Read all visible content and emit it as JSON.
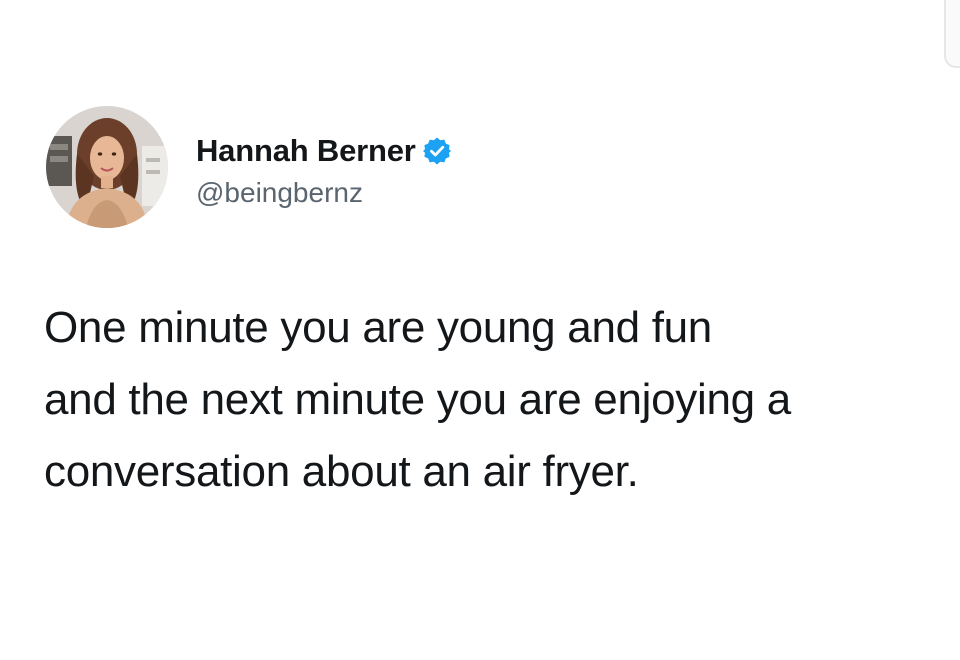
{
  "tweet": {
    "author": {
      "display_name": "Hannah Berner",
      "handle": "@beingbernz",
      "verified": true,
      "avatar_icon": "profile-photo",
      "verified_icon": "verified-badge-icon"
    },
    "text_lines": [
      "One minute you are young and fun",
      "and the next minute you are enjoying a",
      "conversation about an air fryer."
    ]
  },
  "colors": {
    "background": "#ffffff",
    "text": "#14171a",
    "handle": "#5b6570",
    "verified": "#1da1f2"
  }
}
